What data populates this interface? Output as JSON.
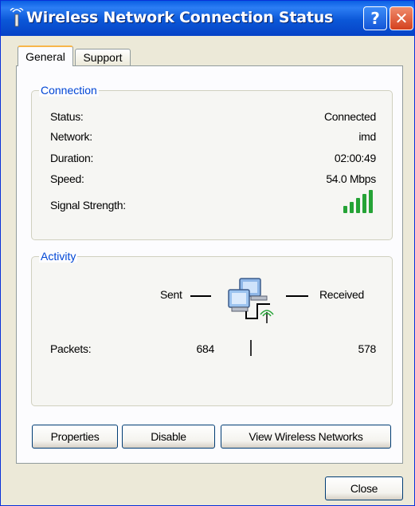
{
  "window": {
    "title": "Wireless Network Connection Status"
  },
  "tabs": [
    {
      "label": "General",
      "selected": true
    },
    {
      "label": "Support",
      "selected": false
    }
  ],
  "connection": {
    "legend": "Connection",
    "rows": [
      {
        "label": "Status:",
        "value": "Connected"
      },
      {
        "label": "Network:",
        "value": "imd"
      },
      {
        "label": "Duration:",
        "value": "02:00:49"
      },
      {
        "label": "Speed:",
        "value": "54.0 Mbps"
      }
    ],
    "signal_label": "Signal Strength:",
    "signal_bars_lit": 5,
    "signal_bars_total": 5
  },
  "activity": {
    "legend": "Activity",
    "sent_label": "Sent",
    "received_label": "Received",
    "packets_label": "Packets:",
    "packets_sent": "684",
    "packets_received": "578",
    "separator": "|"
  },
  "buttons": {
    "properties": "Properties",
    "disable": "Disable",
    "view_wireless": "View Wireless Networks",
    "close": "Close"
  },
  "colors": {
    "titlebar": "#0b57d7",
    "legend_text": "#0046d5",
    "signal_bars": "#25a336",
    "tab_highlight": "#f7b64a"
  }
}
